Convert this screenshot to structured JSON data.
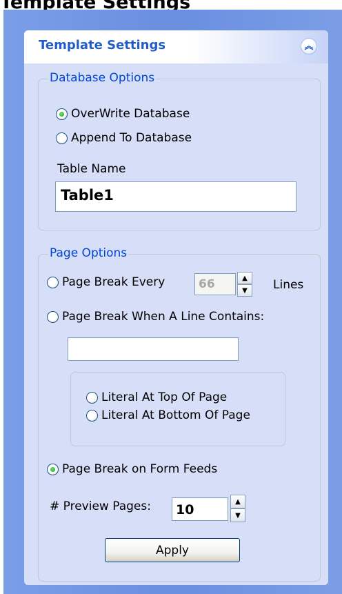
{
  "page_heading": "Template Settings",
  "panel": {
    "title": "Template Settings",
    "collapse_icon": "double-chevron-up-icon"
  },
  "database_options": {
    "legend": "Database Options",
    "overwrite_label": "OverWrite Database",
    "overwrite_checked": true,
    "append_label": "Append To Database",
    "append_checked": false,
    "table_name_label": "Table Name",
    "table_name_value": "Table1"
  },
  "page_options": {
    "legend": "Page Options",
    "break_every_label": "Page Break Every",
    "break_every_value": "66",
    "break_every_suffix": "Lines",
    "break_when_label": "Page Break When A Line Contains:",
    "break_when_value": "",
    "literal_top_label": "Literal At Top Of Page",
    "literal_bottom_label": "Literal At Bottom Of Page",
    "form_feeds_label": "Page Break on Form Feeds",
    "form_feeds_checked": true,
    "preview_pages_label": "# Preview Pages:",
    "preview_pages_value": "10",
    "apply_label": "Apply"
  },
  "colors": {
    "accent": "#215dc6",
    "legend": "#0046d5",
    "panel_bg": "#d6dff7",
    "outer_bg": "#6f93e3"
  }
}
